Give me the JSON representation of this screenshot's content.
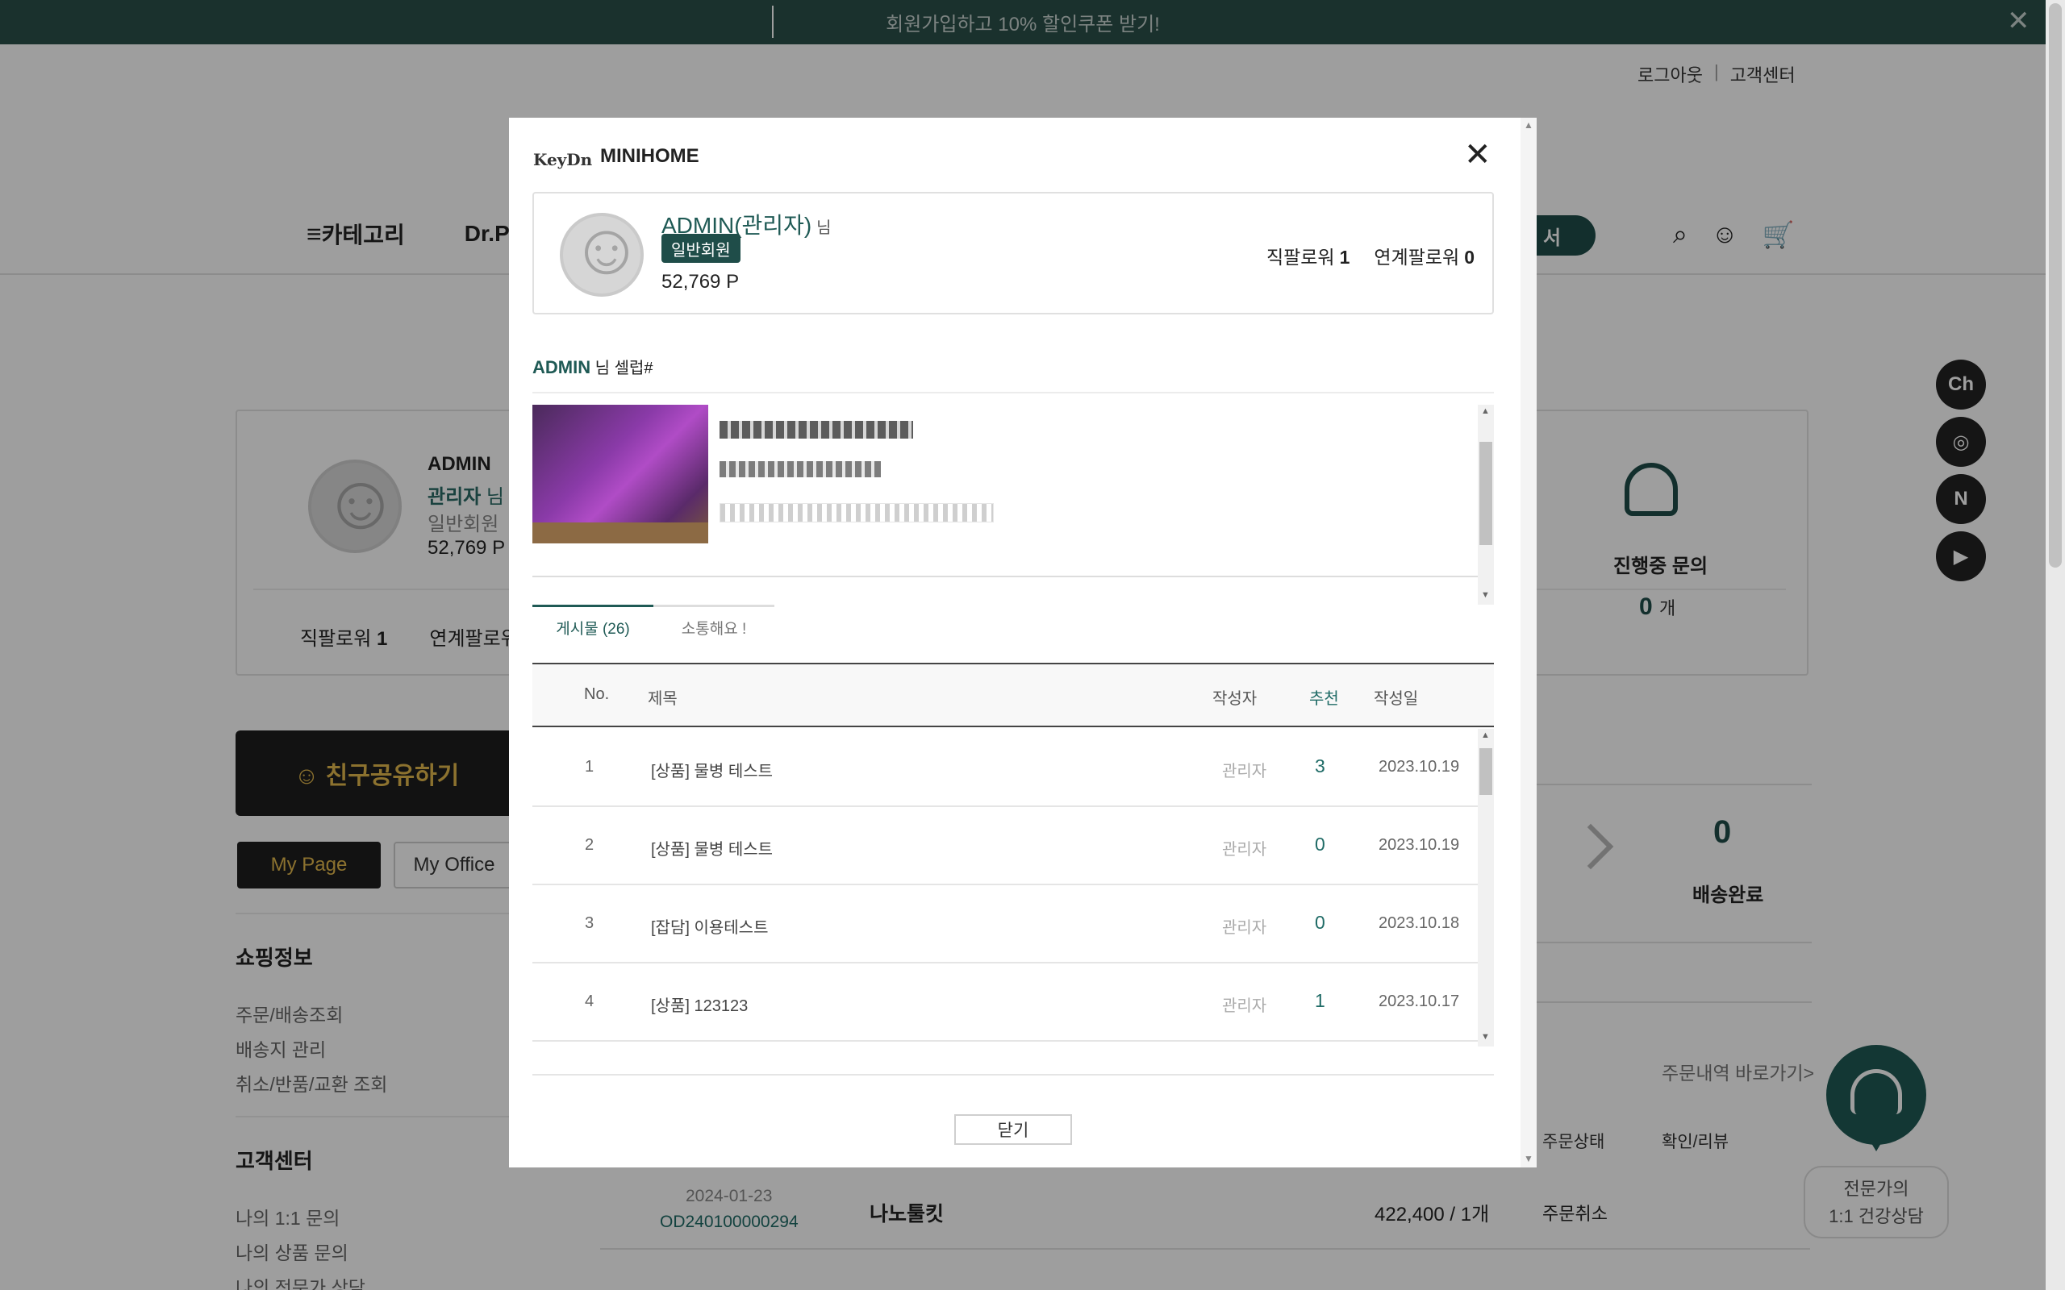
{
  "topbar": {
    "promo": "회원가입하고 10% 할인쿠폰 받기!",
    "close_icon": "close-icon"
  },
  "util": {
    "logout": "로그아웃",
    "sep": "|",
    "support": "고객센터"
  },
  "gnb": {
    "menu_icon": "≡",
    "category": "카테고리",
    "brand": "Dr.Pa",
    "pill": "서",
    "search_icon": "search-icon",
    "user_icon": "user-icon",
    "cart_icon": "cart-icon"
  },
  "profile": {
    "name": "ADMIN",
    "role": "관리자",
    "role_suffix": "님",
    "grade": "일반회원",
    "point": "52,769 P",
    "follow_direct_label": "직팔로워",
    "follow_direct": "1",
    "follow_linked_label": "연계팔로워",
    "inquiry_label": "진행중 문의",
    "inquiry_count": "0",
    "inquiry_unit": "개"
  },
  "left": {
    "share": "☺ 친구공유하기",
    "tab_mypage": "My Page",
    "tab_myoffice": "My Office",
    "shopping_title": "쇼핑정보",
    "shopping_items": [
      "주문/배송조회",
      "배송지 관리",
      "취소/반품/교환 조회"
    ],
    "support_title": "고객센터",
    "support_items": [
      "나의 1:1 문의",
      "나의 상품 문의",
      "나의 전문가 상담"
    ]
  },
  "delivery": {
    "count": "0",
    "label": "배송완료"
  },
  "orders": {
    "link": "주문내역 바로가기>",
    "head_status": "주문상태",
    "head_review": "확인/리뷰",
    "rows": [
      {
        "date": "2024-01-23",
        "no": "OD240100000294",
        "name": "나노툴킷",
        "price": "422,400 / 1개",
        "status": "주문취소"
      }
    ]
  },
  "sns": [
    "Ch",
    "◎",
    "N",
    "▶"
  ],
  "consult": {
    "line1": "전문가의",
    "line2": "1:1 건강상담"
  },
  "modal": {
    "logo": "KeyDn",
    "title": "MINIHOME",
    "name": "ADMIN(관리자)",
    "name_suffix": "님",
    "grade": "일반회원",
    "point": "52,769 P",
    "follow_direct_label": "직팔로워",
    "follow_direct": "1",
    "follow_linked_label": "연계팔로워",
    "follow_linked": "0",
    "sub_name": "ADMIN",
    "sub_suffix": "님 셀럽#",
    "tabs": [
      "게시물 (26)",
      "소통해요 !"
    ],
    "table_head": {
      "no": "No.",
      "title": "제목",
      "author": "작성자",
      "rec": "추천",
      "date": "작성일"
    },
    "rows": [
      {
        "no": "1",
        "title": "[상품] 물병 테스트",
        "author": "관리자",
        "rec": "3",
        "date": "2023.10.19"
      },
      {
        "no": "2",
        "title": "[상품] 물병 테스트",
        "author": "관리자",
        "rec": "0",
        "date": "2023.10.19"
      },
      {
        "no": "3",
        "title": "[잡담] 이용테스트",
        "author": "관리자",
        "rec": "0",
        "date": "2023.10.18"
      },
      {
        "no": "4",
        "title": "[상품] 123123",
        "author": "관리자",
        "rec": "1",
        "date": "2023.10.17"
      }
    ],
    "close_button": "닫기"
  }
}
